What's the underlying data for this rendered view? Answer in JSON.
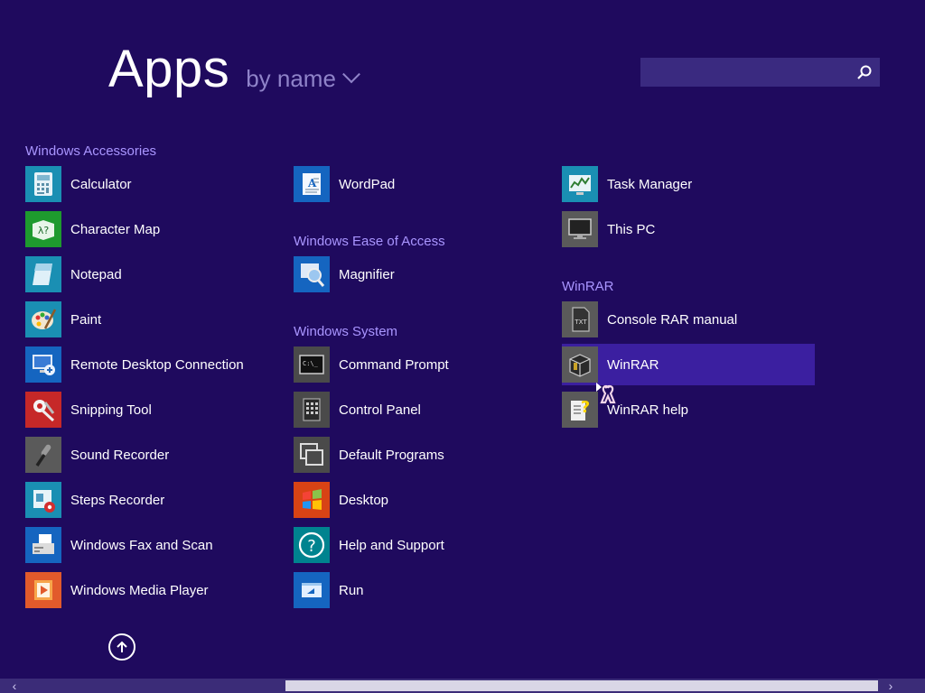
{
  "header": {
    "title": "Apps",
    "sort_label": "by name"
  },
  "search": {
    "value": "",
    "placeholder": ""
  },
  "groups": {
    "windows_accessories": "Windows Accessories",
    "windows_ease_of_access": "Windows Ease of Access",
    "windows_system": "Windows System",
    "winrar": "WinRAR"
  },
  "apps": {
    "calculator": "Calculator",
    "character_map": "Character Map",
    "notepad": "Notepad",
    "paint": "Paint",
    "remote_desktop": "Remote Desktop Connection",
    "snipping_tool": "Snipping Tool",
    "sound_recorder": "Sound Recorder",
    "steps_recorder": "Steps Recorder",
    "fax_scan": "Windows Fax and Scan",
    "media_player": "Windows Media Player",
    "wordpad": "WordPad",
    "magnifier": "Magnifier",
    "command_prompt": "Command Prompt",
    "control_panel": "Control Panel",
    "default_programs": "Default Programs",
    "desktop": "Desktop",
    "help_support": "Help and Support",
    "run": "Run",
    "task_manager": "Task Manager",
    "this_pc": "This PC",
    "console_rar_manual": "Console RAR manual",
    "winrar": "WinRAR",
    "winrar_help": "WinRAR help"
  },
  "colors": {
    "background": "#1f0a5e",
    "group_label": "#a995ff",
    "selection": "#3b1fa0",
    "search_bg": "#3a2a80"
  },
  "icons": {
    "search": "magnifier-icon",
    "sort": "chevron-down-icon",
    "scroll_top": "arrow-up-circle-icon"
  }
}
